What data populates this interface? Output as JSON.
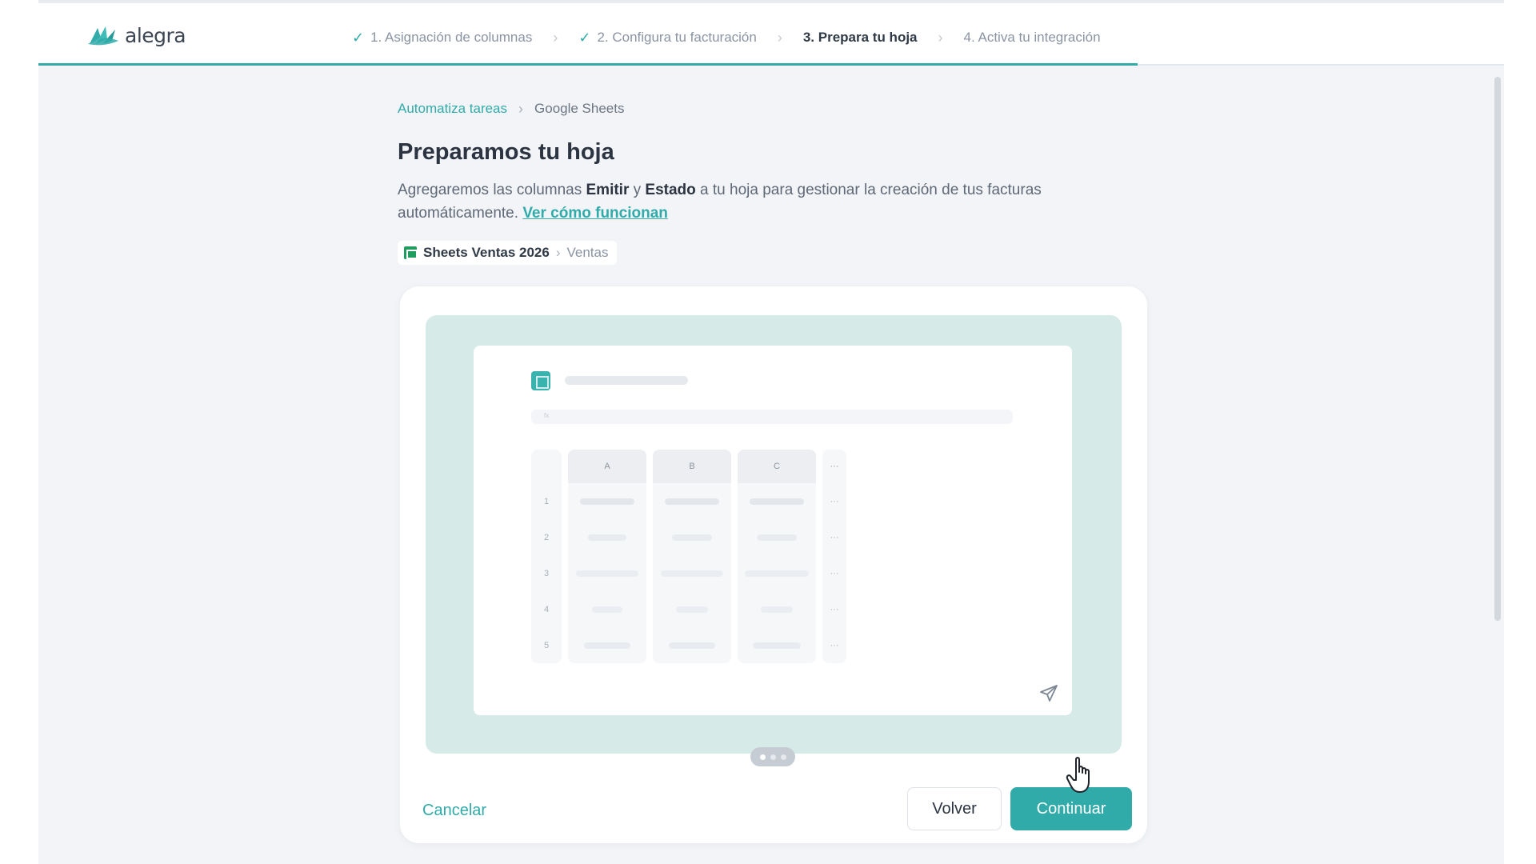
{
  "app": {
    "logo_text": "alegra",
    "brand_color": "#30aba9"
  },
  "steps": [
    {
      "label": "1. Asignación de columnas",
      "state": "done"
    },
    {
      "label": "2. Configura tu facturación",
      "state": "done"
    },
    {
      "label": "3. Prepara tu hoja",
      "state": "active"
    },
    {
      "label": "4. Activa tu integración",
      "state": "pending"
    }
  ],
  "progress_fraction": 0.75,
  "breadcrumb": {
    "parent": "Automatiza tareas",
    "current": "Google Sheets"
  },
  "page": {
    "title": "Preparamos tu hoja",
    "desc_1": "Agregaremos las columnas ",
    "desc_col_1": "Emitir",
    "desc_2": " y ",
    "desc_col_2": "Estado",
    "desc_3": " a tu hoja para gestionar la creación de tus facturas automáticamente. ",
    "desc_link": "Ver cómo funcionan"
  },
  "sheet": {
    "name": "Sheets Ventas 2026",
    "tab": "Ventas"
  },
  "preview": {
    "formula_prefix": "fx",
    "columns": [
      "A",
      "B",
      "C"
    ],
    "more": "···",
    "rows": [
      "1",
      "2",
      "3",
      "4",
      "5"
    ],
    "carousel_count": 3,
    "carousel_active": 0
  },
  "actions": {
    "cancel": "Cancelar",
    "back": "Volver",
    "continue": "Continuar"
  }
}
